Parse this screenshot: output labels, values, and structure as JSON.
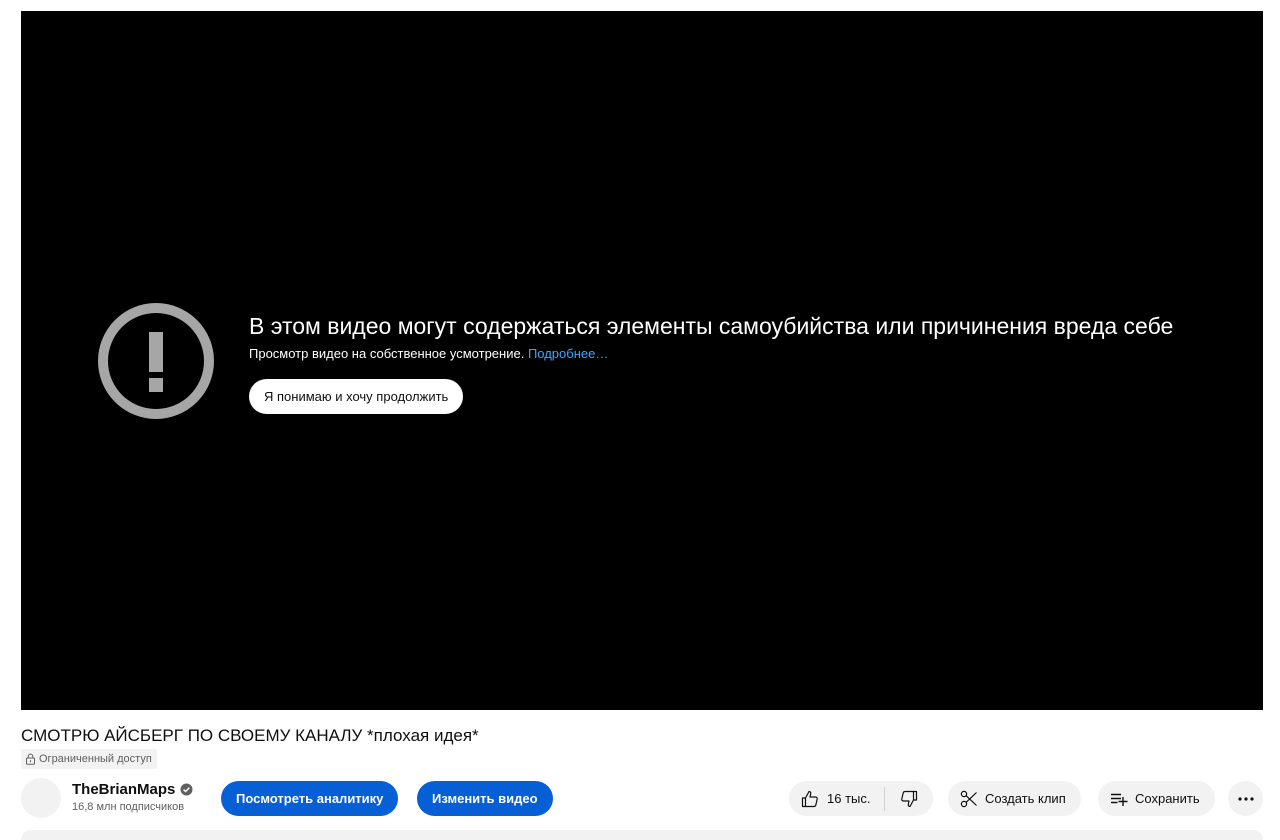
{
  "player": {
    "warning_title": "В этом видео могут содержаться элементы самоубийства или причинения вреда себе",
    "warning_subtitle": "Просмотр видео на собственное усмотрение.",
    "learn_more": "Подробнее…",
    "continue_button": "Я понимаю и хочу продолжить",
    "icon": "exclamation-circle-icon"
  },
  "video": {
    "title": "СМОТРЮ АЙСБЕРГ ПО СВОЕМУ КАНАЛУ *плохая идея*",
    "visibility_badge": "Ограниченный доступ"
  },
  "channel": {
    "name": "TheBrianMaps",
    "subscribers": "16,8 млн подписчиков",
    "verified": true
  },
  "actions": {
    "analytics_button": "Посмотреть аналитику",
    "edit_button": "Изменить видео",
    "likes": "16 тыс.",
    "clip_button": "Создать клип",
    "save_button": "Сохранить"
  },
  "colors": {
    "accent": "#065fd4",
    "link": "#3ea6ff",
    "player_bg": "#000000",
    "chip_bg": "#f2f2f2"
  }
}
